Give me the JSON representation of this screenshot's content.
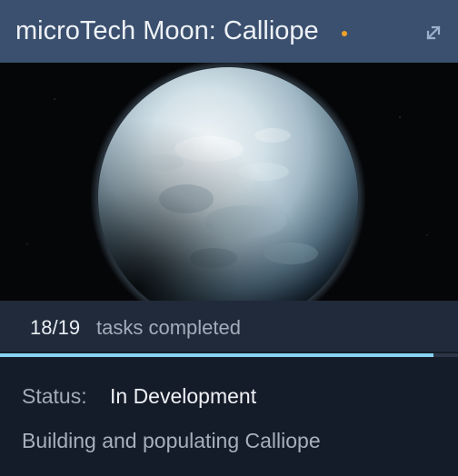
{
  "card": {
    "title": "microTech Moon: Calliope",
    "status_dot_color": "#f0a12a",
    "expand_icon": "expand-diagonal-arrows-icon",
    "hero_image": "moon-calliope-image"
  },
  "progress": {
    "completed": 18,
    "total": 19,
    "count_text": "18/19",
    "label": "tasks completed",
    "fraction": 0.9474,
    "bar_color": "#86d2f2"
  },
  "status": {
    "label": "Status:",
    "value": "In Development"
  },
  "description": "Building and populating Calliope"
}
